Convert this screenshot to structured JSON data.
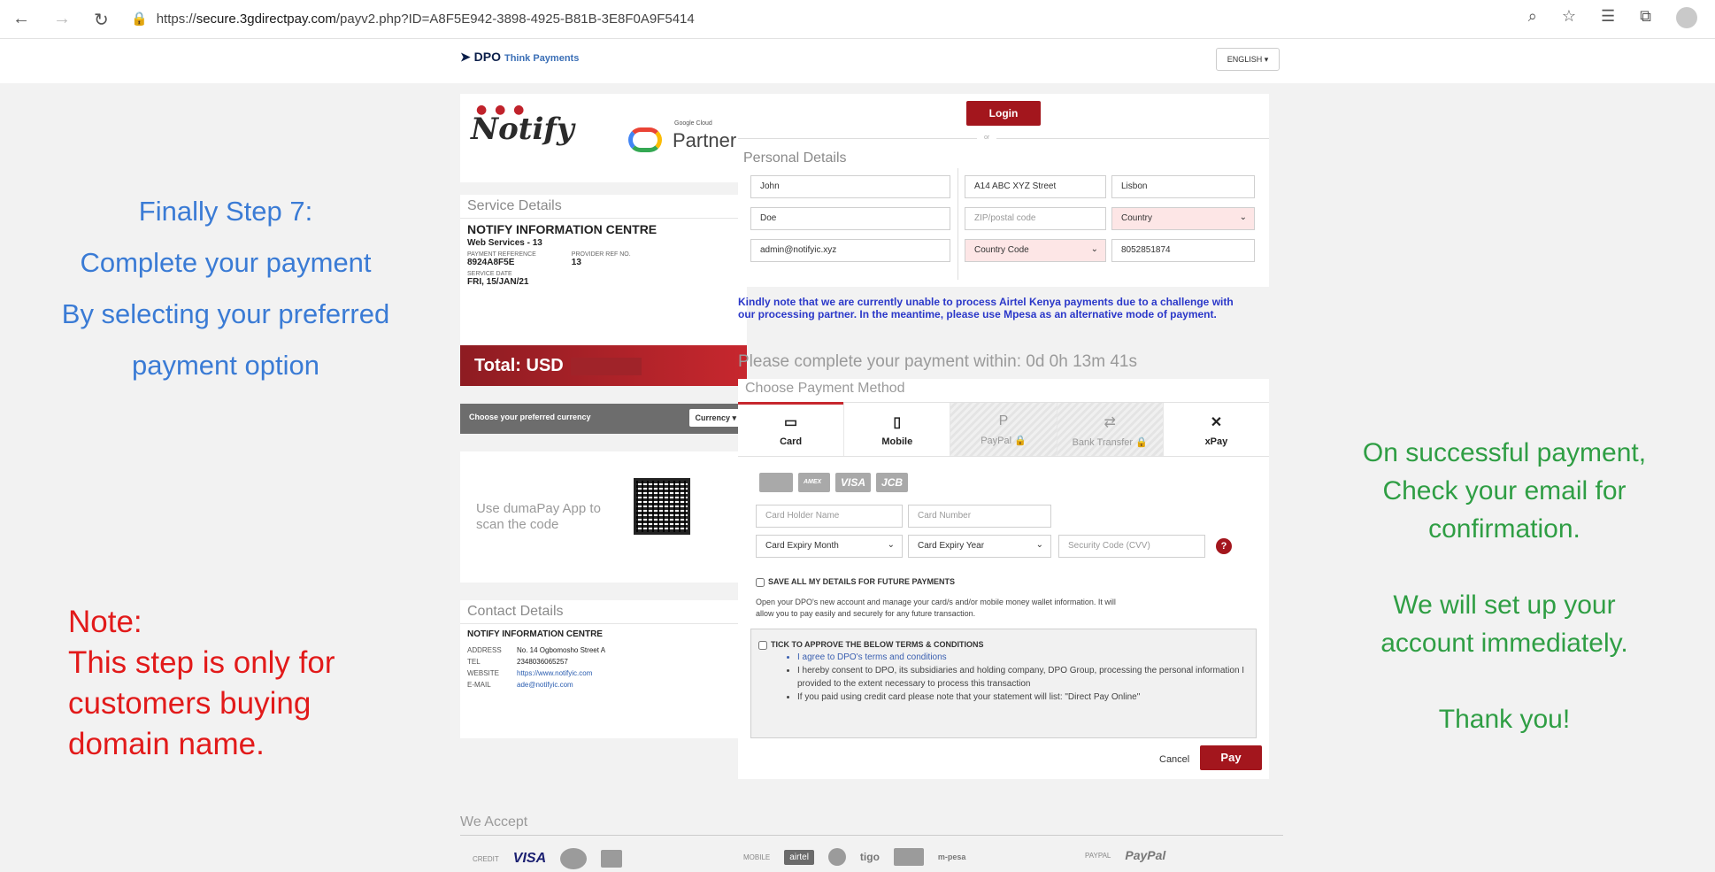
{
  "browser": {
    "url_prefix": "https://",
    "url_host": "secure.3gdirectpay.com",
    "url_path": "/payv2.php?ID=A8F5E942-3898-4925-B81B-3E8F0A9F5414"
  },
  "header": {
    "brand": "DPO",
    "tagline": "Think Payments",
    "language": "ENGLISH ▾"
  },
  "overlay_left": {
    "lines": [
      "Finally Step 7:",
      "Complete your payment",
      "By selecting your preferred",
      "payment option"
    ]
  },
  "overlay_note": {
    "lines": [
      "Note:",
      "This step is only for",
      "customers buying",
      "domain name."
    ]
  },
  "overlay_right": {
    "lines": [
      "On successful payment,",
      "Check your email for",
      "confirmation.",
      "",
      "We will set up your",
      "account immediately.",
      "",
      "Thank you!"
    ]
  },
  "merchant_logo": {
    "name": "Notify",
    "partner_small": "Google Cloud",
    "partner_big": "Partner"
  },
  "service": {
    "title": "Service Details",
    "company": "NOTIFY INFORMATION CENTRE",
    "description": "Web Services - 13",
    "payment_ref_label": "PAYMENT REFERENCE",
    "payment_ref": "8924A8F5E",
    "provider_ref_label": "PROVIDER REF NO.",
    "provider_ref": "13",
    "date_label": "SERVICE DATE",
    "date": "FRI, 15/JAN/21",
    "total_label": "Total: USD"
  },
  "currency": {
    "label": "Choose your preferred currency",
    "select": "Currency ▾"
  },
  "qr": {
    "text": "Use dumaPay App to scan the code"
  },
  "contact": {
    "title": "Contact Details",
    "company": "NOTIFY INFORMATION CENTRE",
    "rows": [
      {
        "k": "ADDRESS",
        "v": "No. 14 Ogbomosho Street A"
      },
      {
        "k": "TEL",
        "v": "2348036065257"
      },
      {
        "k": "WEBSITE",
        "v": "https://www.notifyic.com"
      },
      {
        "k": "E-MAIL",
        "v": "ade@notifyic.com"
      }
    ]
  },
  "personal": {
    "login": "Login",
    "or": "or",
    "title": "Personal Details",
    "first_name": "John",
    "last_name": "Doe",
    "email": "admin@notifyic.xyz",
    "street": "A14 ABC XYZ Street",
    "city": "Lisbon",
    "zip_placeholder": "ZIP/postal code",
    "country": "Country",
    "country_code": "Country Code",
    "phone": "8052851874"
  },
  "notice": "Kindly note that we are currently unable to process Airtel Kenya payments due to a challenge with our processing partner. In the meantime, please use Mpesa as an alternative mode of payment.",
  "countdown": "Please complete your payment within: 0d 0h 13m 41s",
  "payment": {
    "title": "Choose Payment Method",
    "tabs": [
      {
        "label": "Card",
        "icon": "card-icon"
      },
      {
        "label": "Mobile",
        "icon": "mobile-icon"
      },
      {
        "label": "PayPal 🔒",
        "icon": "paypal-icon"
      },
      {
        "label": "Bank Transfer 🔒",
        "icon": "bank-transfer-icon"
      },
      {
        "label": "xPay",
        "icon": "xpay-icon"
      }
    ],
    "brands": [
      "",
      "AMEX",
      "VISA",
      "JCB"
    ],
    "card_holder_placeholder": "Card Holder Name",
    "card_number_placeholder": "Card Number",
    "expiry_month": "Card Expiry Month",
    "expiry_year": "Card Expiry Year",
    "cvv_placeholder": "Security Code (CVV)",
    "help": "?",
    "save_label": "SAVE ALL MY DETAILS FOR FUTURE PAYMENTS",
    "save_info": "Open your DPO's new account and manage your card/s and/or mobile money wallet information. It will allow you to pay easily and securely for any future transaction.",
    "terms_title": "TICK TO APPROVE THE BELOW TERMS & CONDITIONS",
    "terms": [
      "I agree to DPO's terms and conditions",
      "I hereby consent to DPO, its subsidiaries and holding company, DPO Group, processing the personal information I provided to the extent necessary to process this transaction",
      "If you paid using credit card please note that your statement will list: \"Direct Pay Online\""
    ],
    "cancel": "Cancel",
    "pay": "Pay"
  },
  "accept": {
    "title": "We Accept",
    "credit": "CREDIT",
    "visa": "VISA",
    "mobile": "MOBILE",
    "airtel": "airtel",
    "tigo": "tigo",
    "mpesa": "m-pesa",
    "paypal_label": "PAYPAL",
    "paypal": "PayPal"
  }
}
